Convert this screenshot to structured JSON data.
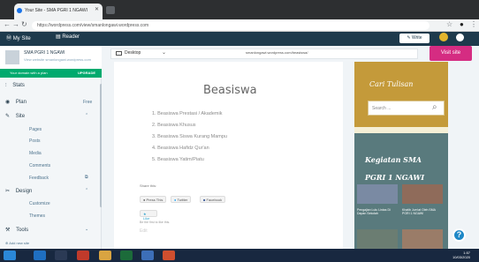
{
  "browser": {
    "tab_title": "Your Site - SMA PGRI 1 NGAWI",
    "url": "https://wordpress.com/view/smanlongawi.wordpress.com"
  },
  "admin_bar": {
    "my_site": "My Site",
    "reader": "Reader",
    "write": "Write"
  },
  "sidebar": {
    "site_name": "SMA PGRI 1 NGAWI",
    "site_url": "View website smanlongawi.wordpress.com",
    "upgrade_text": "Your domain with a plan",
    "upgrade_cta": "UPGRADE",
    "nav": [
      {
        "label": "Stats"
      },
      {
        "label": "Plan",
        "badge": "Free"
      },
      {
        "label": "Site"
      },
      {
        "label": "Pages"
      },
      {
        "label": "Posts"
      },
      {
        "label": "Media"
      },
      {
        "label": "Comments"
      },
      {
        "label": "Feedback"
      },
      {
        "label": "Design"
      },
      {
        "label": "Customize"
      },
      {
        "label": "Themes"
      },
      {
        "label": "Tools"
      },
      {
        "label": "Add new site"
      }
    ]
  },
  "toolbar": {
    "device": "Desktop",
    "preview_url": "smanlongawi.wordpress.com/beasiswa/",
    "visit_site": "Visit site"
  },
  "page": {
    "title": "Beasiswa",
    "items": [
      "1. Beasiswa Prestasi / Akademik",
      "2. Beasiswa Khusus",
      "3. Beasiswa Siswa Kurang Mampu",
      "4. Beasiswa Hafidz Qur'an",
      "5. Beasiswa Yatim/Piatu"
    ],
    "share_label": "Share this:",
    "share_buttons": [
      "Press This",
      "Twitter",
      "Facebook"
    ],
    "like": "Like",
    "like_sub": "Be the first to like this.",
    "edit": "Edit"
  },
  "widgets": {
    "search_title": "Cari Tulisan",
    "search_placeholder": "Search ...",
    "activities_title": "Kegiatan SMA PGRI 1 NGAWI",
    "captions": [
      "Pengajian Lulu Lintas Di Dapan Sekolah",
      "Khatib Jum'at Oleh SMA PGRI 1 NGAWI"
    ]
  },
  "taskbar": {
    "time": "1:57",
    "date": "10/03/2020"
  },
  "colors": {
    "admin_bar": "#1e3a4c",
    "upgrade_green": "#00aa6e",
    "visit_pink": "#d52c82",
    "search_widget": "#c49a3a",
    "activity_widget": "#597a7d"
  }
}
